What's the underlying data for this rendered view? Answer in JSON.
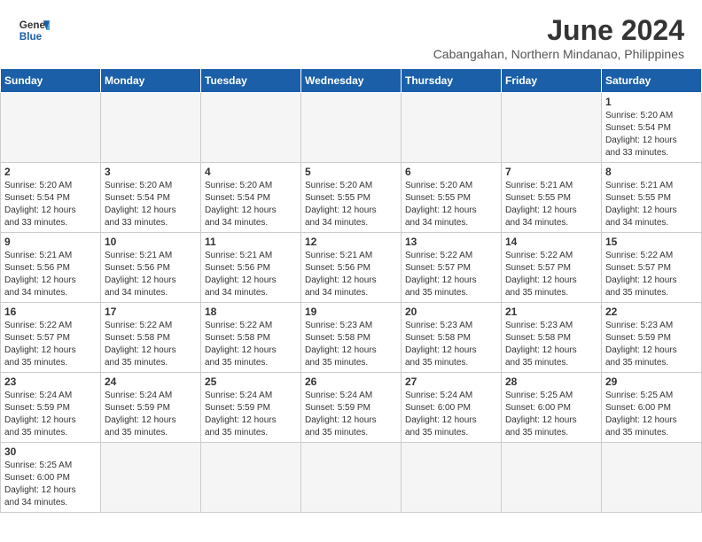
{
  "header": {
    "logo_line1": "General",
    "logo_line2": "Blue",
    "month_year": "June 2024",
    "location": "Cabangahan, Northern Mindanao, Philippines"
  },
  "days_of_week": [
    "Sunday",
    "Monday",
    "Tuesday",
    "Wednesday",
    "Thursday",
    "Friday",
    "Saturday"
  ],
  "weeks": [
    [
      {
        "day": "",
        "info": "",
        "empty": true
      },
      {
        "day": "",
        "info": "",
        "empty": true
      },
      {
        "day": "",
        "info": "",
        "empty": true
      },
      {
        "day": "",
        "info": "",
        "empty": true
      },
      {
        "day": "",
        "info": "",
        "empty": true
      },
      {
        "day": "",
        "info": "",
        "empty": true
      },
      {
        "day": "1",
        "info": "Sunrise: 5:20 AM\nSunset: 5:54 PM\nDaylight: 12 hours\nand 33 minutes."
      }
    ],
    [
      {
        "day": "2",
        "info": "Sunrise: 5:20 AM\nSunset: 5:54 PM\nDaylight: 12 hours\nand 33 minutes."
      },
      {
        "day": "3",
        "info": "Sunrise: 5:20 AM\nSunset: 5:54 PM\nDaylight: 12 hours\nand 33 minutes."
      },
      {
        "day": "4",
        "info": "Sunrise: 5:20 AM\nSunset: 5:54 PM\nDaylight: 12 hours\nand 34 minutes."
      },
      {
        "day": "5",
        "info": "Sunrise: 5:20 AM\nSunset: 5:55 PM\nDaylight: 12 hours\nand 34 minutes."
      },
      {
        "day": "6",
        "info": "Sunrise: 5:20 AM\nSunset: 5:55 PM\nDaylight: 12 hours\nand 34 minutes."
      },
      {
        "day": "7",
        "info": "Sunrise: 5:21 AM\nSunset: 5:55 PM\nDaylight: 12 hours\nand 34 minutes."
      },
      {
        "day": "8",
        "info": "Sunrise: 5:21 AM\nSunset: 5:55 PM\nDaylight: 12 hours\nand 34 minutes."
      }
    ],
    [
      {
        "day": "9",
        "info": "Sunrise: 5:21 AM\nSunset: 5:56 PM\nDaylight: 12 hours\nand 34 minutes."
      },
      {
        "day": "10",
        "info": "Sunrise: 5:21 AM\nSunset: 5:56 PM\nDaylight: 12 hours\nand 34 minutes."
      },
      {
        "day": "11",
        "info": "Sunrise: 5:21 AM\nSunset: 5:56 PM\nDaylight: 12 hours\nand 34 minutes."
      },
      {
        "day": "12",
        "info": "Sunrise: 5:21 AM\nSunset: 5:56 PM\nDaylight: 12 hours\nand 34 minutes."
      },
      {
        "day": "13",
        "info": "Sunrise: 5:22 AM\nSunset: 5:57 PM\nDaylight: 12 hours\nand 35 minutes."
      },
      {
        "day": "14",
        "info": "Sunrise: 5:22 AM\nSunset: 5:57 PM\nDaylight: 12 hours\nand 35 minutes."
      },
      {
        "day": "15",
        "info": "Sunrise: 5:22 AM\nSunset: 5:57 PM\nDaylight: 12 hours\nand 35 minutes."
      }
    ],
    [
      {
        "day": "16",
        "info": "Sunrise: 5:22 AM\nSunset: 5:57 PM\nDaylight: 12 hours\nand 35 minutes."
      },
      {
        "day": "17",
        "info": "Sunrise: 5:22 AM\nSunset: 5:58 PM\nDaylight: 12 hours\nand 35 minutes."
      },
      {
        "day": "18",
        "info": "Sunrise: 5:22 AM\nSunset: 5:58 PM\nDaylight: 12 hours\nand 35 minutes."
      },
      {
        "day": "19",
        "info": "Sunrise: 5:23 AM\nSunset: 5:58 PM\nDaylight: 12 hours\nand 35 minutes."
      },
      {
        "day": "20",
        "info": "Sunrise: 5:23 AM\nSunset: 5:58 PM\nDaylight: 12 hours\nand 35 minutes."
      },
      {
        "day": "21",
        "info": "Sunrise: 5:23 AM\nSunset: 5:58 PM\nDaylight: 12 hours\nand 35 minutes."
      },
      {
        "day": "22",
        "info": "Sunrise: 5:23 AM\nSunset: 5:59 PM\nDaylight: 12 hours\nand 35 minutes."
      }
    ],
    [
      {
        "day": "23",
        "info": "Sunrise: 5:24 AM\nSunset: 5:59 PM\nDaylight: 12 hours\nand 35 minutes."
      },
      {
        "day": "24",
        "info": "Sunrise: 5:24 AM\nSunset: 5:59 PM\nDaylight: 12 hours\nand 35 minutes."
      },
      {
        "day": "25",
        "info": "Sunrise: 5:24 AM\nSunset: 5:59 PM\nDaylight: 12 hours\nand 35 minutes."
      },
      {
        "day": "26",
        "info": "Sunrise: 5:24 AM\nSunset: 5:59 PM\nDaylight: 12 hours\nand 35 minutes."
      },
      {
        "day": "27",
        "info": "Sunrise: 5:24 AM\nSunset: 6:00 PM\nDaylight: 12 hours\nand 35 minutes."
      },
      {
        "day": "28",
        "info": "Sunrise: 5:25 AM\nSunset: 6:00 PM\nDaylight: 12 hours\nand 35 minutes."
      },
      {
        "day": "29",
        "info": "Sunrise: 5:25 AM\nSunset: 6:00 PM\nDaylight: 12 hours\nand 35 minutes."
      }
    ],
    [
      {
        "day": "30",
        "info": "Sunrise: 5:25 AM\nSunset: 6:00 PM\nDaylight: 12 hours\nand 34 minutes."
      },
      {
        "day": "",
        "info": "",
        "empty": true
      },
      {
        "day": "",
        "info": "",
        "empty": true
      },
      {
        "day": "",
        "info": "",
        "empty": true
      },
      {
        "day": "",
        "info": "",
        "empty": true
      },
      {
        "day": "",
        "info": "",
        "empty": true
      },
      {
        "day": "",
        "info": "",
        "empty": true
      }
    ]
  ]
}
